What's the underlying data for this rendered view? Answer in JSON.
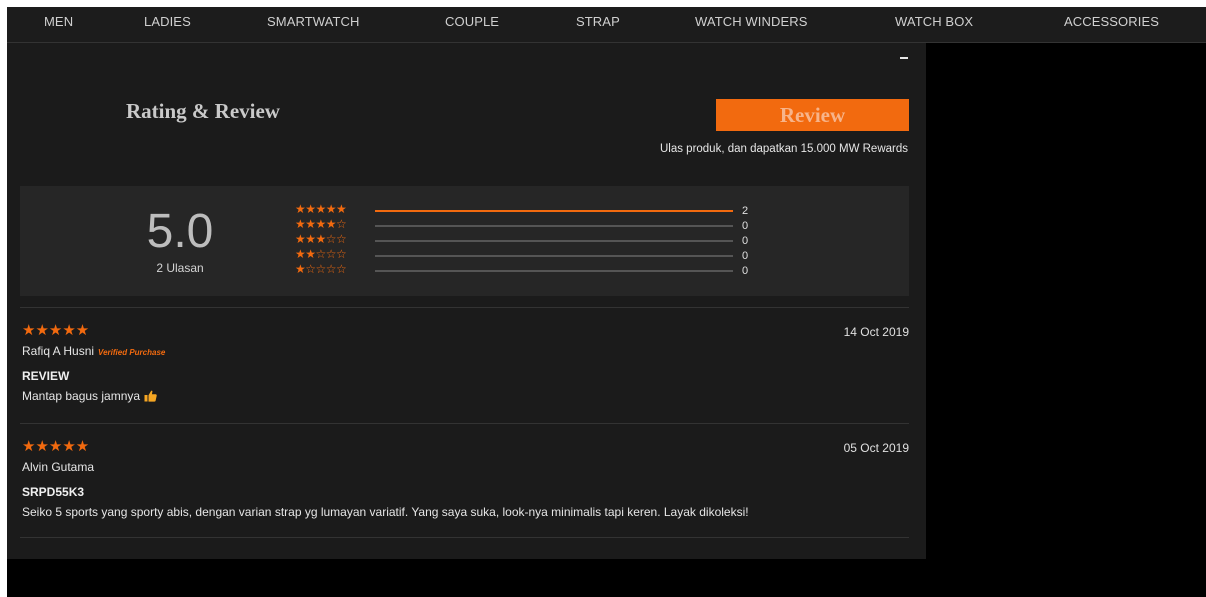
{
  "nav": {
    "items": [
      {
        "label": "MEN"
      },
      {
        "label": "LADIES"
      },
      {
        "label": "SMARTWATCH"
      },
      {
        "label": "COUPLE"
      },
      {
        "label": "STRAP"
      },
      {
        "label": "WATCH WINDERS"
      },
      {
        "label": "WATCH BOX"
      },
      {
        "label": "ACCESSORIES"
      }
    ]
  },
  "rating_section": {
    "collapse_icon": "minus-icon",
    "title": "Rating & Review",
    "review_button_label": "Review",
    "promo_text": "Ulas produk, dan dapatkan 15.000 MW Rewards"
  },
  "summary": {
    "average": "5.0",
    "count_label": "2 Ulasan",
    "distribution": [
      {
        "stars": "★★★★★",
        "count": "2",
        "fraction": 1.0
      },
      {
        "stars": "★★★★☆",
        "count": "0",
        "fraction": 0
      },
      {
        "stars": "★★★☆☆",
        "count": "0",
        "fraction": 0
      },
      {
        "stars": "★★☆☆☆",
        "count": "0",
        "fraction": 0
      },
      {
        "stars": "★☆☆☆☆",
        "count": "0",
        "fraction": 0
      }
    ]
  },
  "reviews": [
    {
      "stars": "★★★★★",
      "date": "14 Oct 2019",
      "author": "Rafiq A Husni",
      "verified": "Verified Purchase",
      "title": "REVIEW",
      "body": "Mantap bagus jamnya",
      "emoji": "thumbs-up-icon"
    },
    {
      "stars": "★★★★★",
      "date": "05 Oct 2019",
      "author": "Alvin Gutama",
      "verified": "",
      "title": "SRPD55K3",
      "body": "Seiko 5 sports yang sporty abis, dengan varian strap yg lumayan variatif. Yang saya suka, look-nya minimalis tapi keren. Layak dikoleksi!"
    }
  ],
  "colors": {
    "accent": "#f26a0f",
    "page_bg": "#000000",
    "panel_bg": "#1b1b1b",
    "summary_bg": "#262626",
    "nav_bg": "#1c1c1c"
  }
}
